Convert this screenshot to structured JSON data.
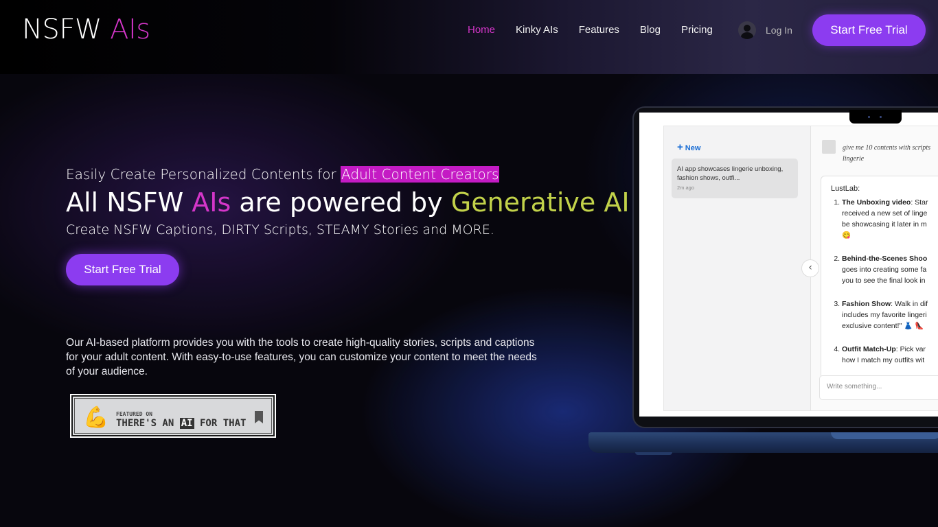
{
  "header": {
    "logo_main": "NSFW ",
    "logo_accent": "AIs",
    "nav": [
      {
        "label": "Home",
        "active": true
      },
      {
        "label": "Kinky AIs"
      },
      {
        "label": "Features"
      },
      {
        "label": "Blog"
      },
      {
        "label": "Pricing"
      }
    ],
    "login_label": "Log In",
    "cta_label": "Start Free Trial"
  },
  "hero": {
    "sub_prefix": "Easily Create Personalized Contents for ",
    "sub_highlight": "Adult Content Creators",
    "headline_1": "All NSFW ",
    "headline_pink": "AIs",
    "headline_2": " are powered by ",
    "headline_green": "Generative AI",
    "subheadline": "Create NSFW Captions, DIRTY Scripts, STEAMY Stories and MORE.",
    "cta_label": "Start Free Trial",
    "description": "Our AI-based platform provides you with the tools to create high-quality stories, scripts and captions for your adult content. With easy-to-use features, you can customize your content to meet the needs of your audience."
  },
  "badge": {
    "featured": "FEATURED ON",
    "text_1": "THERE'S AN ",
    "text_ai": "AI",
    "text_2": " FOR THAT"
  },
  "app_preview": {
    "new_label": "New",
    "conversation_title": "AI app showcases lingerie unboxing, fashion shows, outfi...",
    "conversation_time": "2m ago",
    "user_message_1": "give me 10 contents with scripts",
    "user_message_2": "lingerie",
    "assistant_name": "LustLab:",
    "items": [
      {
        "title": "The Unboxing video",
        "line1": ": Star",
        "line2": "received a new set of linge",
        "line3": "be showcasing it later in m",
        "line4": "😋"
      },
      {
        "title": "Behind-the-Scenes Shoo",
        "line1": "",
        "line2": "goes into creating some fa",
        "line3": "you to see the final look in"
      },
      {
        "title": "Fashion Show",
        "line1": ": Walk in dif",
        "line2": "includes my favorite lingeri",
        "line3": "exclusive content!\" 👗 👠"
      },
      {
        "title": "Outfit Match-Up",
        "line1": ": Pick var",
        "line2": "how I match my outfits wit"
      }
    ],
    "input_placeholder": "Write something..."
  },
  "colors": {
    "accent_pink": "#d436c9",
    "accent_green": "#c2d24a",
    "button_purple": "#8c3cf0",
    "highlight_magenta": "#c41bc4"
  }
}
